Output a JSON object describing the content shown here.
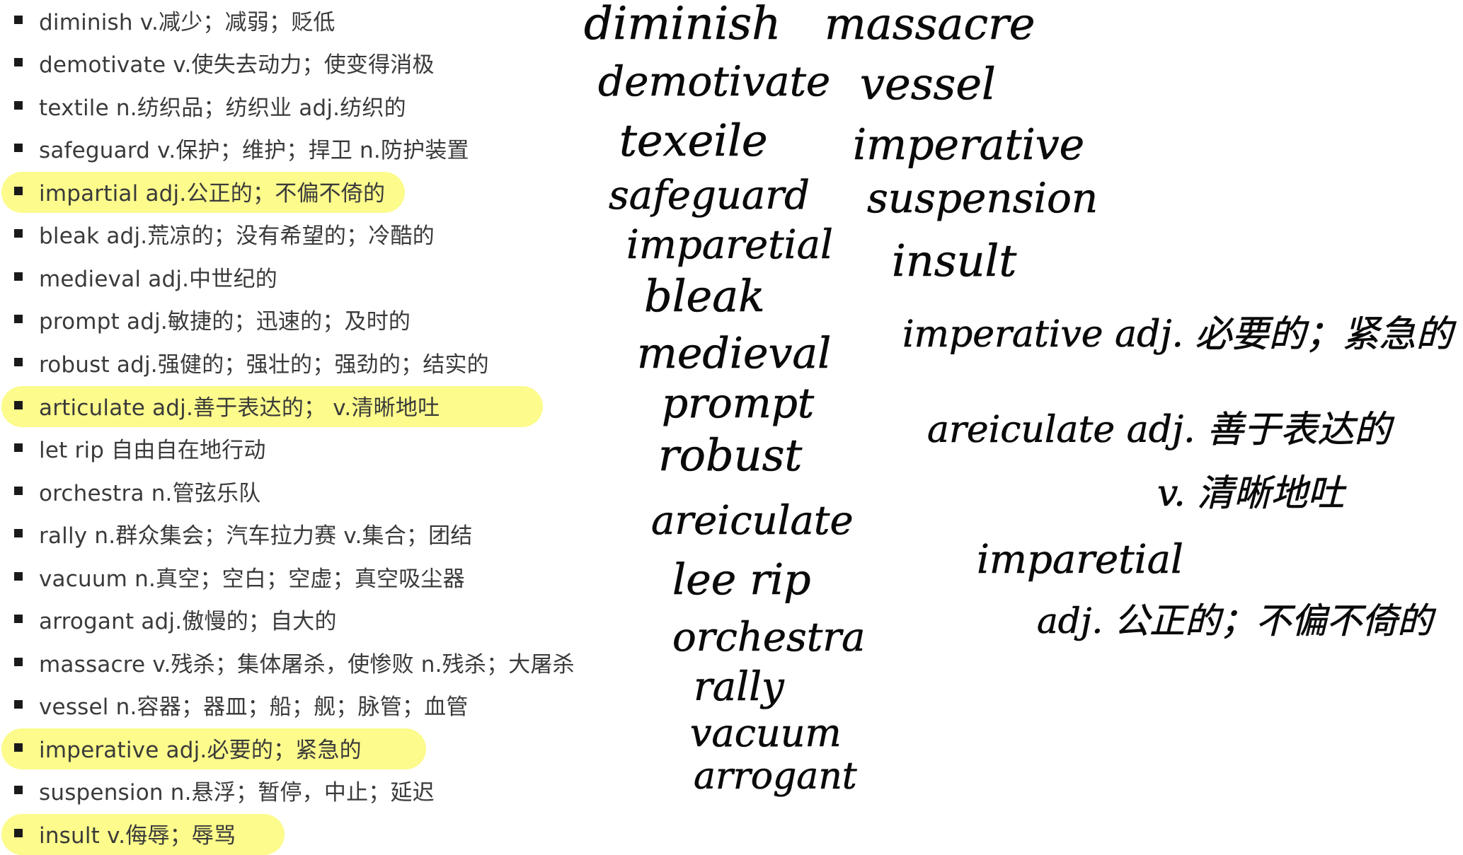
{
  "vocab": [
    {
      "text": "diminish v.减少；减弱；贬低",
      "highlighted": false
    },
    {
      "text": "demotivate v.使失去动力；使变得消极",
      "highlighted": false
    },
    {
      "text": "textile n.纺织品；纺织业 adj.纺织的",
      "highlighted": false
    },
    {
      "text": "safeguard v.保护；维护；捍卫 n.防护装置",
      "highlighted": false
    },
    {
      "text": "impartial adj.公正的；不偏不倚的",
      "highlighted": true
    },
    {
      "text": "bleak adj.荒凉的；没有希望的；冷酷的",
      "highlighted": false
    },
    {
      "text": "medieval adj.中世纪的",
      "highlighted": false
    },
    {
      "text": "prompt adj.敏捷的；迅速的；及时的",
      "highlighted": false
    },
    {
      "text": "robust adj.强健的；强壮的；强劲的；结实的",
      "highlighted": false
    },
    {
      "text": "articulate adj.善于表达的； v.清晰地吐",
      "highlighted": true
    },
    {
      "text": "let rip 自由自在地行动",
      "highlighted": false
    },
    {
      "text": "orchestra n.管弦乐队",
      "highlighted": false
    },
    {
      "text": "rally n.群众集会；汽车拉力赛 v.集合；团结",
      "highlighted": false
    },
    {
      "text": "vacuum n.真空；空白；空虚；真空吸尘器",
      "highlighted": false
    },
    {
      "text": "arrogant adj.傲慢的；自大的",
      "highlighted": false
    },
    {
      "text": "massacre v.残杀；集体屠杀，使惨败 n.残杀；大屠杀",
      "highlighted": false
    },
    {
      "text": "vessel n.容器；器皿；船；舰；脉管；血管",
      "highlighted": false
    },
    {
      "text": "imperative adj.必要的；紧急的",
      "highlighted": true
    },
    {
      "text": "suspension n.悬浮；暂停，中止；延迟",
      "highlighted": false
    },
    {
      "text": "insult v.侮辱；辱骂",
      "highlighted": true
    }
  ],
  "handwriting": {
    "column1": [
      "diminish",
      "demotivate",
      "texeile",
      "safeguard",
      "imparetial",
      "bleak",
      "medieval",
      "prompt",
      "robust",
      "areiculate",
      "lee rip",
      "orchestra",
      "rally",
      "vacuum",
      "arrogant"
    ],
    "column2": [
      "massacre",
      "vessel",
      "imperative",
      "suspension",
      "insult"
    ],
    "notes": [
      "imperative adj. 必要的；紧急的",
      "areiculate  adj. 善于表达的",
      "v. 清晰地吐",
      "imparetial",
      "adj. 公正的；不偏不倚的"
    ]
  },
  "colors": {
    "highlight": "#fcfb8c",
    "text": "#3a3a3a",
    "ink": "#0a0a0a",
    "bullet": "#1a1a1a"
  }
}
